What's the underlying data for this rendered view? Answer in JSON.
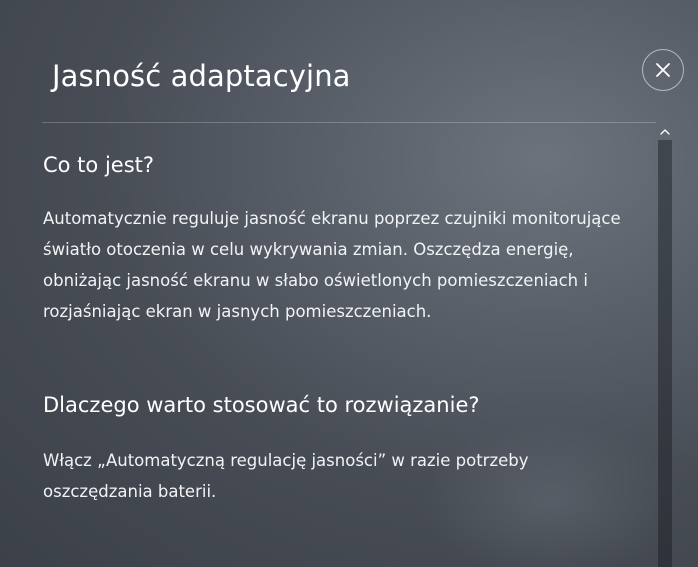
{
  "dialog": {
    "title": "Jasność adaptacyjna",
    "close_icon": "close-icon"
  },
  "sections": [
    {
      "heading": "Co to jest?",
      "lines": [
        "Automatycznie reguluje jasność ekranu poprzez czujniki monitorujące",
        "światło otoczenia w celu wykrywania zmian. Oszczędza energię,",
        "obniżając jasność ekranu w słabo oświetlonych pomieszczeniach i",
        "rozjaśniając ekran w jasnych pomieszczeniach."
      ]
    },
    {
      "heading": "Dlaczego warto stosować to rozwiązanie?",
      "lines": [
        "Włącz „Automatyczną regulację jasności” w razie potrzeby",
        "oszczędzania baterii."
      ]
    }
  ],
  "scrollbar": {
    "up_icon": "chevron-up-icon"
  }
}
